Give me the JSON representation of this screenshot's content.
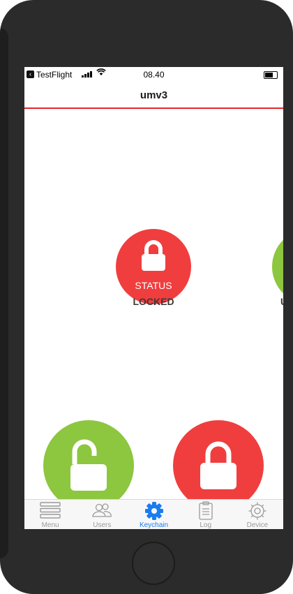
{
  "statusbar": {
    "app": "TestFlight",
    "time": "08.40",
    "back_icon": "back-chevron-icon"
  },
  "navbar": {
    "title": "umv3"
  },
  "status_card": {
    "label": "STATUS",
    "state": "LOCKED",
    "color": "#f03e3e"
  },
  "peek_card": {
    "state": "U",
    "color": "#8dc63f"
  },
  "actions": {
    "unlock_color": "#8dc63f",
    "lock_color": "#f03e3e"
  },
  "tabbar": {
    "items": [
      {
        "label": "Menu",
        "icon": "menu-icon",
        "active": false
      },
      {
        "label": "Users",
        "icon": "users-icon",
        "active": false
      },
      {
        "label": "Keychain",
        "icon": "gear-icon",
        "active": true
      },
      {
        "label": "Log",
        "icon": "clipboard-icon",
        "active": false
      },
      {
        "label": "Device",
        "icon": "gear-outline-icon",
        "active": false
      }
    ],
    "active_color": "#1a7cf0",
    "inactive_color": "#9a9a9a"
  }
}
